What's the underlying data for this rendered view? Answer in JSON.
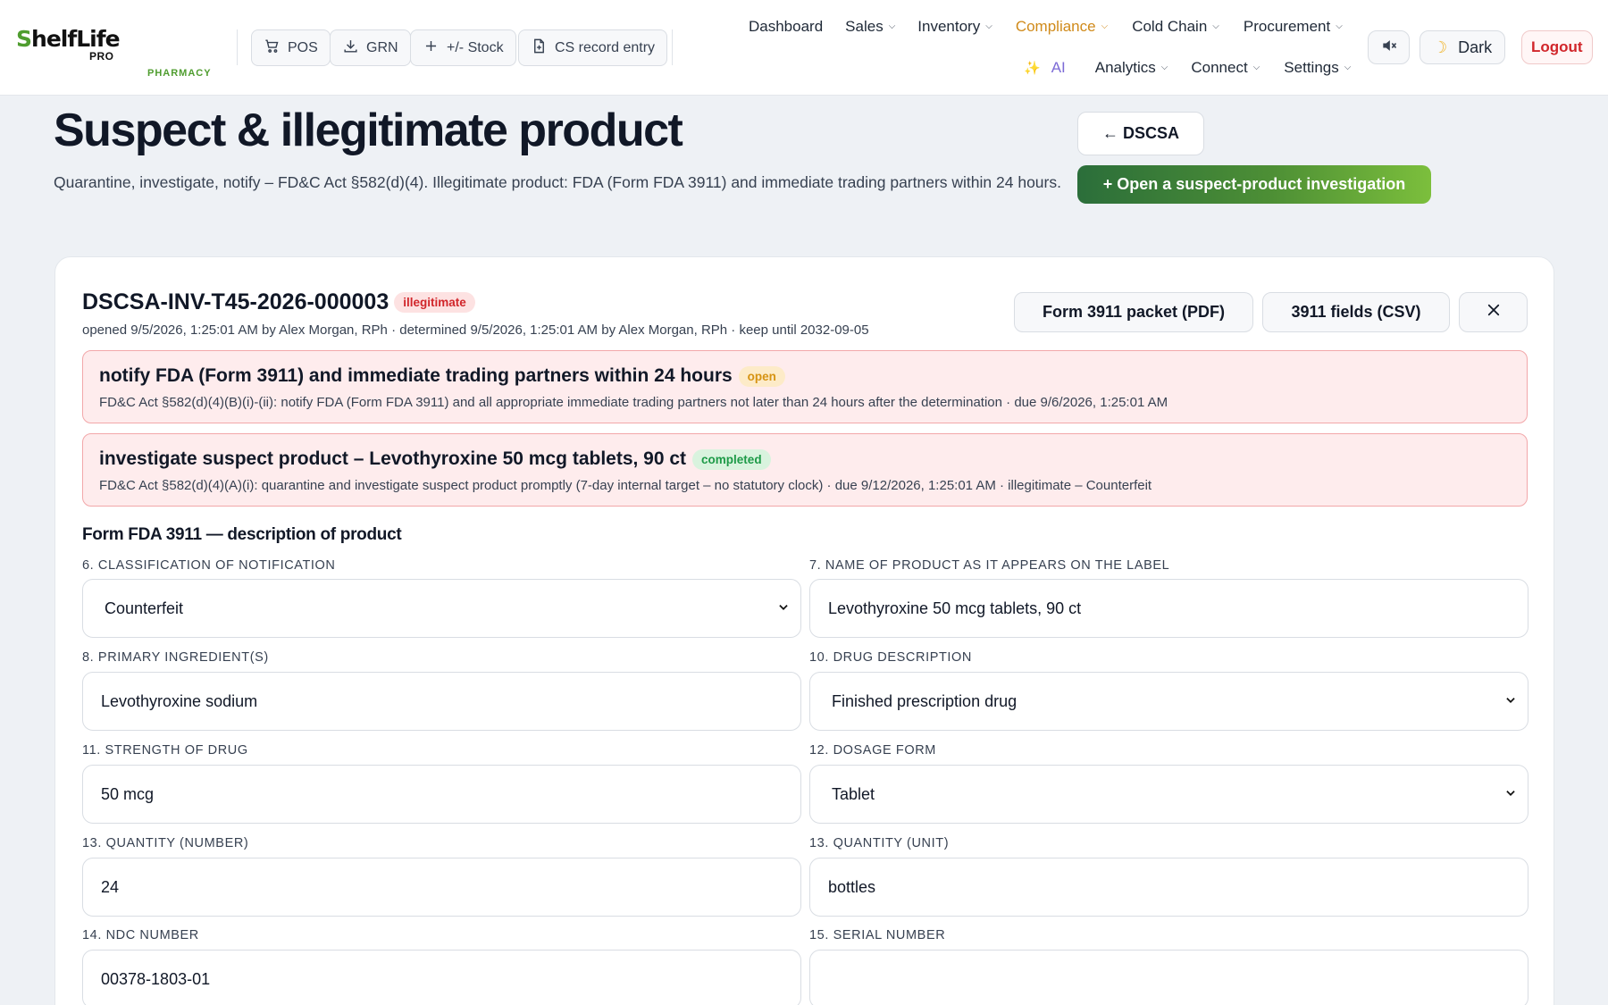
{
  "app": {
    "logo_text": "ShelfLife",
    "logo_sub": "PRO",
    "logo_tag": "PHARMACY"
  },
  "quick_actions": [
    {
      "label": "POS",
      "icon": "cart-icon"
    },
    {
      "label": "GRN",
      "icon": "download-icon"
    },
    {
      "label": "+/- Stock",
      "icon": "plus-icon"
    },
    {
      "label": "CS record entry",
      "icon": "document-icon"
    }
  ],
  "nav": {
    "row1": [
      {
        "label": "Dashboard",
        "dropdown": false
      },
      {
        "label": "Sales",
        "dropdown": true
      },
      {
        "label": "Inventory",
        "dropdown": true
      },
      {
        "label": "Compliance",
        "dropdown": true,
        "active": true
      },
      {
        "label": "Cold Chain",
        "dropdown": true
      },
      {
        "label": "Procurement",
        "dropdown": true
      }
    ],
    "row2": [
      {
        "label": "AI",
        "dropdown": false
      },
      {
        "label": "Analytics",
        "dropdown": true
      },
      {
        "label": "Connect",
        "dropdown": true
      },
      {
        "label": "Settings",
        "dropdown": true
      }
    ],
    "dark_label": "Dark",
    "logout_label": "Logout"
  },
  "colors": {
    "accent_active": "#d08a1a",
    "brand_green": "#4f9d2f",
    "danger": "#d1262b"
  },
  "page": {
    "title": "Suspect & illegitimate product",
    "subtitle": "Quarantine, investigate, notify – FD&C Act §582(d)(4). Illegitimate product: FDA (Form FDA 3911) and immediate trading partners within 24 hours.",
    "back_label": "← DSCSA",
    "open_label": "+ Open a suspect-product investigation"
  },
  "investigation": {
    "id": "DSCSA-INV-T45-2026-000003",
    "status_badge": "illegitimate",
    "meta": "opened 9/5/2026, 1:25:01 AM by Alex Morgan, RPh · determined 9/5/2026, 1:25:01 AM by Alex Morgan, RPh · keep until 2032-09-05",
    "pdf_label": "Form 3911 packet (PDF)",
    "csv_label": "3911 fields (CSV)",
    "alerts": [
      {
        "title": "notify FDA (Form 3911) and immediate trading partners within 24 hours",
        "badge": "open",
        "detail": "FD&C Act §582(d)(4)(B)(i)-(ii): notify FDA (Form FDA 3911) and all appropriate immediate trading partners not later than 24 hours after the determination · due 9/6/2026, 1:25:01 AM"
      },
      {
        "title": "investigate suspect product – Levothyroxine 50 mcg tablets, 90 ct",
        "badge": "completed",
        "detail": "FD&C Act §582(d)(4)(A)(i): quarantine and investigate suspect product promptly (7-day internal target – no statutory clock) · due 9/12/2026, 1:25:01 AM · illegitimate – Counterfeit"
      }
    ],
    "form_title": "Form FDA 3911 — description of product",
    "fields": [
      {
        "label": "6. CLASSIFICATION OF NOTIFICATION",
        "value": "Counterfeit",
        "type": "select"
      },
      {
        "label": "7. NAME OF PRODUCT AS IT APPEARS ON THE LABEL",
        "value": "Levothyroxine 50 mcg tablets, 90 ct",
        "type": "input"
      },
      {
        "label": "8. PRIMARY INGREDIENT(S)",
        "value": "Levothyroxine sodium",
        "type": "input"
      },
      {
        "label": "10. DRUG DESCRIPTION",
        "value": "Finished prescription drug",
        "type": "select"
      },
      {
        "label": "11. STRENGTH OF DRUG",
        "value": "50 mcg",
        "type": "input"
      },
      {
        "label": "12. DOSAGE FORM",
        "value": "Tablet",
        "type": "select"
      },
      {
        "label": "13. QUANTITY (NUMBER)",
        "value": "24",
        "type": "input"
      },
      {
        "label": "13. QUANTITY (UNIT)",
        "value": "bottles",
        "type": "input"
      },
      {
        "label": "14. NDC NUMBER",
        "value": "00378-1803-01",
        "type": "input"
      },
      {
        "label": "15. SERIAL NUMBER",
        "value": "",
        "type": "input"
      }
    ]
  }
}
